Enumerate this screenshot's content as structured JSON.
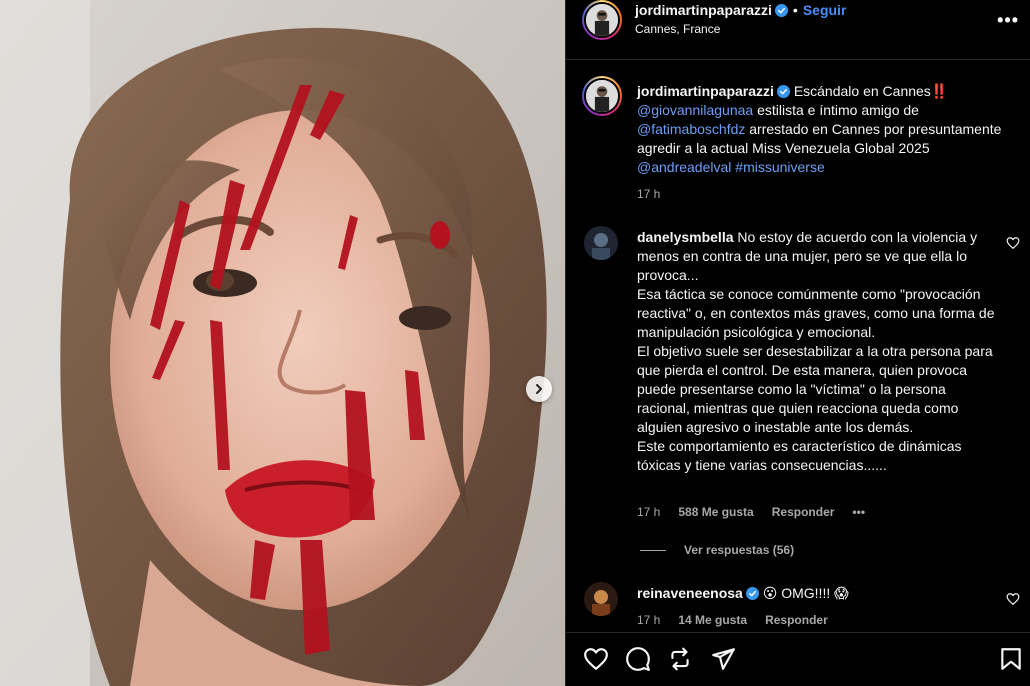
{
  "post": {
    "author": "jordimartinpaparazzi",
    "follow_label": "Seguir",
    "dot": "•",
    "location": "Cannes, France",
    "more_label": "•••"
  },
  "caption": {
    "author": "jordimartinpaparazzi",
    "title": "Escándalo en Cannes",
    "exclamation": "‼️",
    "mention1": "@giovannilagunaa",
    "text1": " estilista e íntimo amigo de ",
    "mention2": "@fatimaboschfdz",
    "text2": " arrestado en Cannes por presuntamente agredir a la actual Miss Venezuela Global 2025 ",
    "mention3": "@andreadelval",
    "hashtag": "#missuniverse",
    "time": "17 h"
  },
  "comments": [
    {
      "author": "danelysmbella",
      "text": "No estoy de acuerdo con la violencia y menos en contra de una mujer, pero se ve que ella lo provoca...\nEsa táctica se conoce comúnmente como \"provocación reactiva\" o, en contextos más graves, como una forma de manipulación psicológica y emocional.\nEl objetivo suele ser desestabilizar a la otra persona para que pierda el control. De esta manera, quien provoca puede presentarse como la \"víctima\" o la persona racional, mientras que quien reacciona queda como alguien agresivo o inestable ante los demás.\nEste comportamiento es característico de dinámicas tóxicas y tiene varias consecuencias......",
      "time": "17 h",
      "likes": "588 Me gusta",
      "reply_label": "Responder",
      "more_label": "•••",
      "view_replies": "Ver respuestas (56)"
    },
    {
      "author": "reinaveneenosa",
      "text": "😮 OMG!!!! 😱",
      "time": "17 h",
      "likes": "14 Me gusta",
      "reply_label": "Responder"
    }
  ],
  "icons": {
    "next": "chevron-right-icon",
    "like": "heart-icon",
    "comment": "comment-icon",
    "repost": "repost-icon",
    "share": "share-icon",
    "save": "bookmark-icon",
    "verified": "verified-badge-icon"
  },
  "colors": {
    "background": "#000000",
    "link": "#6d9ef7",
    "follow": "#4a8cf7",
    "muted": "#a8a8a8",
    "verified": "#3897f0"
  }
}
